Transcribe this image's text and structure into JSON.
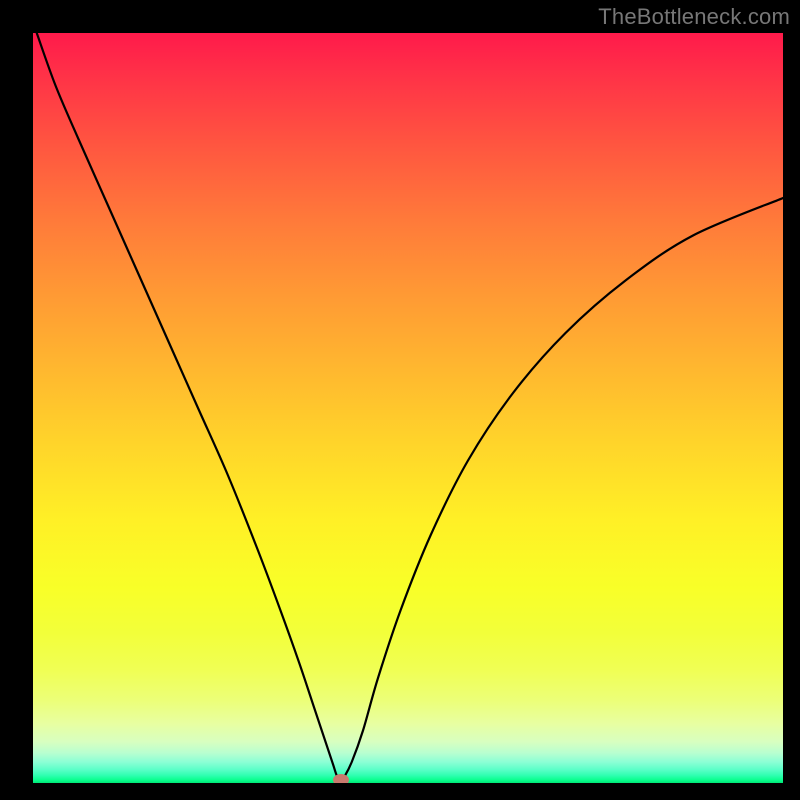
{
  "watermark": "TheBottleneck.com",
  "chart_data": {
    "type": "line",
    "title": "",
    "xlabel": "",
    "ylabel": "",
    "xlim": [
      0,
      100
    ],
    "ylim": [
      0,
      100
    ],
    "series": [
      {
        "name": "curve",
        "x": [
          0.5,
          3,
          6,
          10,
          14,
          18,
          22,
          26,
          30,
          33,
          35.5,
          37.5,
          39,
          40,
          40.5,
          41,
          41.5,
          42.5,
          44,
          46,
          49,
          53,
          58,
          64,
          71,
          79,
          88,
          100
        ],
        "y": [
          100,
          93,
          86,
          77,
          68,
          59,
          50,
          41,
          31,
          23,
          16,
          10,
          5.5,
          2.5,
          1,
          0.2,
          0.8,
          2.8,
          7,
          14,
          23,
          33,
          43,
          52,
          60,
          67,
          73,
          78
        ]
      }
    ],
    "marker": {
      "name": "optimal-point",
      "x": 41,
      "y": 0.4
    },
    "colors": {
      "frame": "#000000",
      "curve": "#000000",
      "marker": "#c97a6e",
      "gradient_top": "#ff1a4b",
      "gradient_mid": "#ffe628",
      "gradient_bottom": "#00e676"
    }
  }
}
